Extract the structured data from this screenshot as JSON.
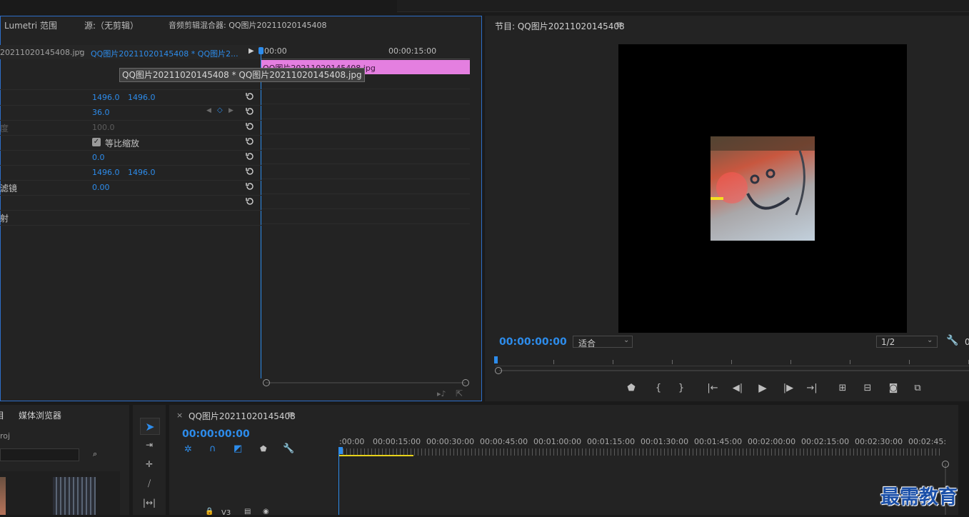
{
  "top_tabs": [
    "Lumetri 范围",
    "源:（无剪辑）",
    "音频剪辑混合器: QQ图片20211020145408"
  ],
  "effect_controls": {
    "clip_master": "20211020145408.jpg",
    "clip_sequence": "QQ图片20211020145408 * QQ图片2...",
    "tooltip": "QQ图片20211020145408 * QQ图片20211020145408.jpg",
    "mini_timeline": {
      "start": "00:00",
      "mid": "00:00:15:00",
      "clip_label": "QQ图片20211020145408.jpg"
    },
    "rows": [
      {
        "label": "",
        "v1": "1496.0",
        "v2": "1496.0"
      },
      {
        "label": "",
        "v1": "36.0"
      },
      {
        "label": "度",
        "v1": "100.0"
      },
      {
        "label": "",
        "checkbox": "等比缩放"
      },
      {
        "label": "",
        "v1": "0.0"
      },
      {
        "label": "",
        "v1": "1496.0",
        "v2": "1496.0"
      },
      {
        "label": "滤镜",
        "v1": "0.00"
      },
      {
        "label": ""
      },
      {
        "label": "射"
      }
    ]
  },
  "program": {
    "title": "节目: QQ图片20211020145408",
    "timecode": "00:00:00:00",
    "fit": "适合",
    "resolution": "1/2",
    "trailing_digit": "0"
  },
  "project": {
    "tab_media": "媒体浏览器",
    "tab_short": "目",
    "path_fragment": "roj"
  },
  "timeline": {
    "tab_title": "QQ图片20211020145408",
    "timecode": "00:00:00:00",
    "ruler": [
      ":00:00",
      "00:00:15:00",
      "00:00:30:00",
      "00:00:45:00",
      "00:01:00:00",
      "00:01:15:00",
      "00:01:30:00",
      "00:01:45:00",
      "00:02:00:00",
      "00:02:15:00",
      "00:02:30:00",
      "00:02:45:"
    ],
    "track": "V3"
  },
  "watermark": "最需教育"
}
